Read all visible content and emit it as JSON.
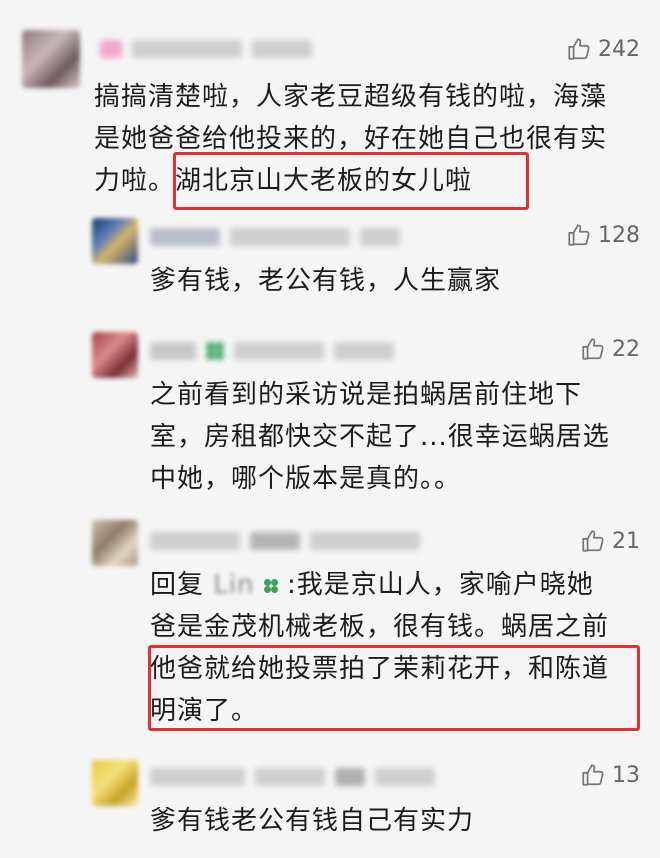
{
  "comments": [
    {
      "likes": "242",
      "text_lines": [
        "搞搞清楚啦，人家老豆超级有钱的啦，海藻",
        "是她爸爸给他投来的，好在她自己也很有实",
        "力啦。湖北京山大老板的女儿啦"
      ]
    },
    {
      "likes": "128",
      "text_lines": [
        "爹有钱，老公有钱，人生赢家"
      ]
    },
    {
      "likes": "22",
      "text_lines": [
        "之前看到的采访说是拍蜗居前住地下",
        "室，房租都快交不起了...很幸运蜗居选",
        "中她，哪个版本是真的。。"
      ]
    },
    {
      "likes": "21",
      "reply_prefix": "回复",
      "reply_to": "Lin",
      "text_lines": [
        ":我是京山人，家喻户晓她",
        "爸是金茂机械老板，很有钱。蜗居之前",
        "他爸就给她投票拍了茉莉花开，和陈道",
        "明演了。"
      ]
    },
    {
      "likes": "13",
      "text_lines": [
        "爹有钱老公有钱自己有实力"
      ]
    }
  ],
  "colors": {
    "background": "#f5f5f5",
    "highlight": "#e53030",
    "like_text": "#666666",
    "body_text": "#1c1c1c"
  }
}
